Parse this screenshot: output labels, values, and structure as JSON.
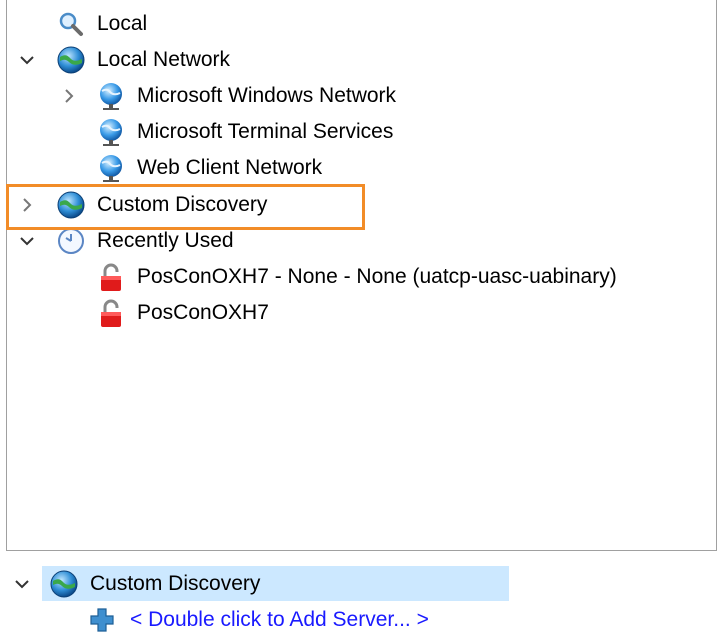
{
  "tree": {
    "items": [
      {
        "label": "Local",
        "icon": "magnifier-icon"
      },
      {
        "label": "Local Network",
        "icon": "network-globe-icon",
        "expanded": true
      },
      {
        "label": "Microsoft Windows Network",
        "icon": "network-globe-blue-icon",
        "expanded": false
      },
      {
        "label": "Microsoft Terminal Services",
        "icon": "network-globe-blue-icon"
      },
      {
        "label": "Web Client Network",
        "icon": "network-globe-blue-icon"
      },
      {
        "label": "Custom Discovery",
        "icon": "network-globe-icon",
        "expanded": false,
        "highlighted": true
      },
      {
        "label": "Recently Used",
        "icon": "clock-icon",
        "expanded": true
      },
      {
        "label": "PosConOXH7 - None - None (uatcp-uasc-uabinary)",
        "icon": "red-lock-icon"
      },
      {
        "label": "PosConOXH7",
        "icon": "red-lock-icon"
      }
    ]
  },
  "bottom": {
    "node_label": "Custom Discovery",
    "node_icon": "network-globe-icon",
    "node_selected": true,
    "add_server_label": "< Double click to Add Server... >",
    "add_server_icon": "plus-icon"
  },
  "colors": {
    "highlight_border": "#f28c28",
    "selection_bg": "#cce8ff",
    "link_text": "#1a1aff"
  }
}
